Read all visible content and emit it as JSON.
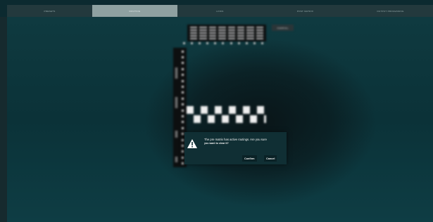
{
  "nav": {
    "tabs": [
      {
        "label": "PRESETS"
      },
      {
        "label": "ROUTING"
      },
      {
        "label": "LINKS"
      },
      {
        "label": "POST MATRIX"
      },
      {
        "label": "OUTPUT PROCESSING"
      }
    ],
    "active_index": 1
  },
  "matrix": {
    "clear_all_label": "CLEAR ALL"
  },
  "dialog": {
    "icon": "warning-icon",
    "message_line1": "The pre matrix has active routings. Are you sure",
    "message_line2": "you want to clear it?",
    "confirm_label": "Confirm",
    "cancel_label": "Cancel"
  },
  "colors": {
    "nav_bg": "#23393d",
    "nav_active": "#8fa1a1",
    "stage_bg": "#0b3238",
    "dialog_bg": "#102f34"
  }
}
